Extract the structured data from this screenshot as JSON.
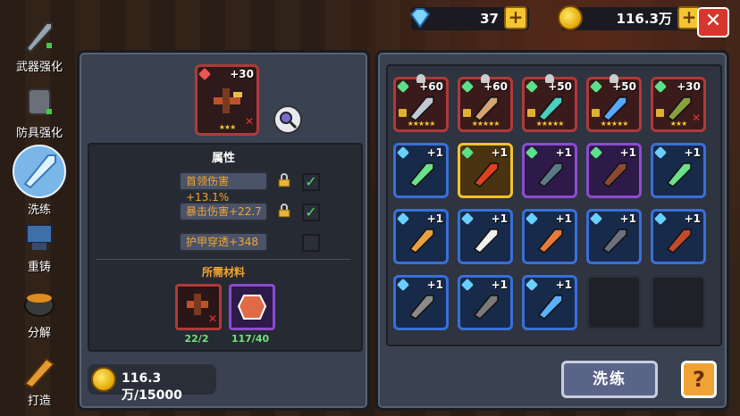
{
  "top": {
    "gems": "37",
    "gold": "116.3万",
    "plus": "+",
    "close": "✕"
  },
  "nav": [
    {
      "label": "武器强化"
    },
    {
      "label": "防具强化"
    },
    {
      "label": "洗练"
    },
    {
      "label": "重铸"
    },
    {
      "label": "分解"
    },
    {
      "label": "打造"
    }
  ],
  "selected": {
    "level": "+30",
    "stars": "★★★"
  },
  "attributes_title": "属性",
  "attributes": [
    {
      "text": "首领伤害+13.1%",
      "locked": true,
      "checked": true
    },
    {
      "text": "暴击伤害+22.7",
      "locked": true,
      "checked": true
    },
    {
      "text": "护甲穿透+348",
      "locked": false,
      "checked": false
    }
  ],
  "materials_title": "所需材料",
  "materials": [
    {
      "count": "22/2"
    },
    {
      "count": "117/40"
    }
  ],
  "gold_cost": "116.3万/15000",
  "wash_button": "洗练",
  "help_button": "?",
  "inventory": [
    {
      "level": "+60",
      "rarity": "red",
      "stars": "★★★★★"
    },
    {
      "level": "+60",
      "rarity": "red",
      "stars": "★★★★★"
    },
    {
      "level": "+50",
      "rarity": "red",
      "stars": "★★★★★"
    },
    {
      "level": "+50",
      "rarity": "red",
      "stars": "★★★★★"
    },
    {
      "level": "+30",
      "rarity": "red",
      "stars": "★★★"
    },
    {
      "level": "+1",
      "rarity": "blue",
      "stars": ""
    },
    {
      "level": "+1",
      "rarity": "yellow",
      "stars": ""
    },
    {
      "level": "+1",
      "rarity": "purple",
      "stars": ""
    },
    {
      "level": "+1",
      "rarity": "purple",
      "stars": ""
    },
    {
      "level": "+1",
      "rarity": "blue",
      "stars": ""
    },
    {
      "level": "+1",
      "rarity": "blue",
      "stars": ""
    },
    {
      "level": "+1",
      "rarity": "blue",
      "stars": ""
    },
    {
      "level": "+1",
      "rarity": "blue",
      "stars": ""
    },
    {
      "level": "+1",
      "rarity": "blue",
      "stars": ""
    },
    {
      "level": "+1",
      "rarity": "blue",
      "stars": ""
    },
    {
      "level": "+1",
      "rarity": "blue",
      "stars": ""
    },
    {
      "level": "+1",
      "rarity": "blue",
      "stars": ""
    },
    {
      "level": "+1",
      "rarity": "blue",
      "stars": ""
    },
    {
      "level": "",
      "rarity": "empty",
      "stars": ""
    },
    {
      "level": "",
      "rarity": "empty",
      "stars": ""
    }
  ]
}
